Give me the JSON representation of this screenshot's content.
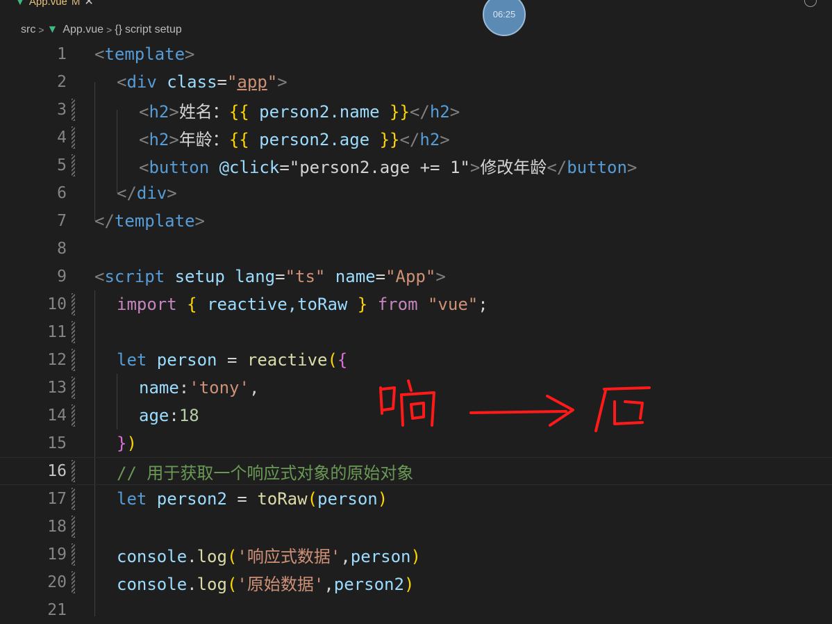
{
  "tab": {
    "filename": "App.vue",
    "status": "M"
  },
  "timer": "06:25",
  "breadcrumb": {
    "folder": "src",
    "file": "App.vue",
    "symbol": "script setup"
  },
  "lines": [
    "1",
    "2",
    "3",
    "4",
    "5",
    "6",
    "7",
    "8",
    "9",
    "10",
    "11",
    "12",
    "13",
    "14",
    "15",
    "16",
    "17",
    "18",
    "19",
    "20",
    "21"
  ],
  "code": {
    "l1": {
      "open": "<",
      "tag": "template",
      "close": ">"
    },
    "l2": {
      "open": "<",
      "tag": "div",
      "attr": "class",
      "eq": "=",
      "q1": "\"",
      "val": "app",
      "q2": "\"",
      "close": ">"
    },
    "l3": {
      "open": "<",
      "tag": "h2",
      "close": ">",
      "text": "姓名：",
      "ob": "{{",
      "expr": " person2.name ",
      "cb": "}}",
      "eopen": "</",
      "etag": "h2",
      "eclose": ">"
    },
    "l4": {
      "open": "<",
      "tag": "h2",
      "close": ">",
      "text": "年龄：",
      "ob": "{{",
      "expr": " person2.age ",
      "cb": "}}",
      "eopen": "</",
      "etag": "h2",
      "eclose": ">"
    },
    "l5": {
      "open": "<",
      "tag": "button",
      "attr": " @click",
      "eq": "=",
      "val": "\"person2.age += 1\"",
      "close": ">",
      "text": "修改年龄",
      "eopen": "</",
      "etag": "button",
      "eclose": ">"
    },
    "l6": {
      "open": "</",
      "tag": "div",
      "close": ">"
    },
    "l7": {
      "open": "</",
      "tag": "template",
      "close": ">"
    },
    "l9": {
      "open": "<",
      "tag": "script",
      "a1": " setup lang",
      "eq1": "=",
      "v1": "\"ts\"",
      "a2": " name",
      "eq2": "=",
      "v2": "\"App\"",
      "close": ">"
    },
    "l10": {
      "kw": "import",
      "ob": " { ",
      "names": "reactive,toRaw",
      "cb": " } ",
      "from": "from",
      "str": " \"vue\"",
      "semi": ";"
    },
    "l12": {
      "let": "let",
      "var": " person",
      "eq": " = ",
      "fn": "reactive",
      "p": "(",
      "b": "{"
    },
    "l13": {
      "key": "name",
      "colon": ":",
      "str": "'tony'",
      "comma": ","
    },
    "l14": {
      "key": "age",
      "colon": ":",
      "num": "18"
    },
    "l15": {
      "b": "}",
      "p": ")"
    },
    "l16": {
      "comment": "// 用于获取一个响应式对象的原始对象"
    },
    "l17": {
      "let": "let",
      "var": " person2",
      "eq": " = ",
      "fn": "toRaw",
      "p1": "(",
      "arg": "person",
      "p2": ")"
    },
    "l19": {
      "obj": "console",
      "dot": ".",
      "fn": "log",
      "p1": "(",
      "str": "'响应式数据'",
      "comma": ",",
      "arg": "person",
      "p2": ")"
    },
    "l20": {
      "obj": "console",
      "dot": ".",
      "fn": "log",
      "p1": "(",
      "str": "'原始数据'",
      "comma": ",",
      "arg": "person2",
      "p2": ")"
    }
  },
  "colors": {
    "background": "#1e1e1e",
    "keyword": "#c586c0",
    "tag": "#569cd6",
    "string": "#ce9178",
    "comment": "#6a9955",
    "annotation": "#ff1a1a"
  },
  "icons": [
    "vue-icon",
    "close-icon",
    "chevron-right-icon",
    "braces-icon",
    "history-icon"
  ]
}
